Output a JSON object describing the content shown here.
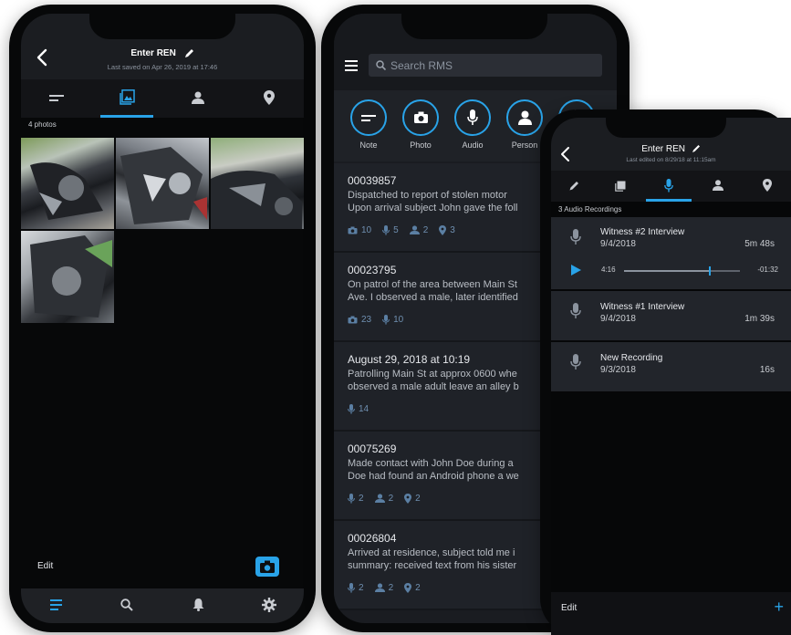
{
  "phone1": {
    "title": "Enter REN",
    "subtitle": "Last saved on Apr 26, 2019 at 17:46",
    "photo_count": "4 photos",
    "edit_label": "Edit",
    "tabs": [
      "narrative-icon",
      "photos-icon",
      "person-icon",
      "location-icon"
    ],
    "active_tab": 1,
    "bottom_nav": [
      "list-icon",
      "search-icon",
      "bell-icon",
      "gear-icon"
    ]
  },
  "phone2": {
    "search_placeholder": "Search RMS",
    "quick_actions": [
      {
        "label": "Note",
        "icon": "note-icon"
      },
      {
        "label": "Photo",
        "icon": "camera-icon"
      },
      {
        "label": "Audio",
        "icon": "mic-icon"
      },
      {
        "label": "Person",
        "icon": "person-icon"
      },
      {
        "label": "",
        "icon": "location-icon"
      }
    ],
    "reports": [
      {
        "id": "00039857",
        "line1": "Dispatched to report of stolen motor",
        "line2": "Upon arrival subject John gave the foll",
        "photos": "10",
        "audio": "5",
        "persons": "2",
        "locations": "3"
      },
      {
        "id": "00023795",
        "line1": "On patrol of the area between Main St",
        "line2": "Ave. I observed a male, later identified",
        "photos": "23",
        "audio": "10",
        "persons": "",
        "locations": ""
      },
      {
        "id": "August 29, 2018 at 10:19",
        "line1": "Patrolling Main St at approx 0600 whe",
        "line2": "observed a male adult leave an alley b",
        "photos": "",
        "audio": "14",
        "persons": "",
        "locations": ""
      },
      {
        "id": "00075269",
        "line1": "Made contact with John Doe during a",
        "line2": "Doe had found an Android phone a we",
        "photos": "",
        "audio": "2",
        "persons": "2",
        "locations": "2"
      },
      {
        "id": "00026804",
        "line1": "Arrived at residence, subject told me i",
        "line2": "summary: received text from his sister",
        "photos": "",
        "audio": "2",
        "persons": "2",
        "locations": "2"
      }
    ]
  },
  "phone3": {
    "title": "Enter REN",
    "subtitle": "Last edited on 8/29/18 at 11:15am",
    "section_label": "3 Audio Recordings",
    "tabs": [
      "pencil-icon",
      "photos-icon",
      "mic-icon",
      "person-icon",
      "location-icon"
    ],
    "active_tab": 2,
    "recordings": [
      {
        "title": "Witness #2 Interview",
        "date": "9/4/2018",
        "duration": "5m 48s",
        "playing": true,
        "elapsed": "4:16",
        "remaining": "-01:32",
        "progress": 0.74
      },
      {
        "title": "Witness #1 Interview",
        "date": "9/4/2018",
        "duration": "1m 39s",
        "playing": false
      },
      {
        "title": "New Recording",
        "date": "9/3/2018",
        "duration": "16s",
        "playing": false
      }
    ],
    "edit_label": "Edit",
    "add_label": "+"
  },
  "colors": {
    "accent": "#29a3e8",
    "panel": "#23262d",
    "bg": "#0d0e10",
    "muted": "#8b939e"
  }
}
